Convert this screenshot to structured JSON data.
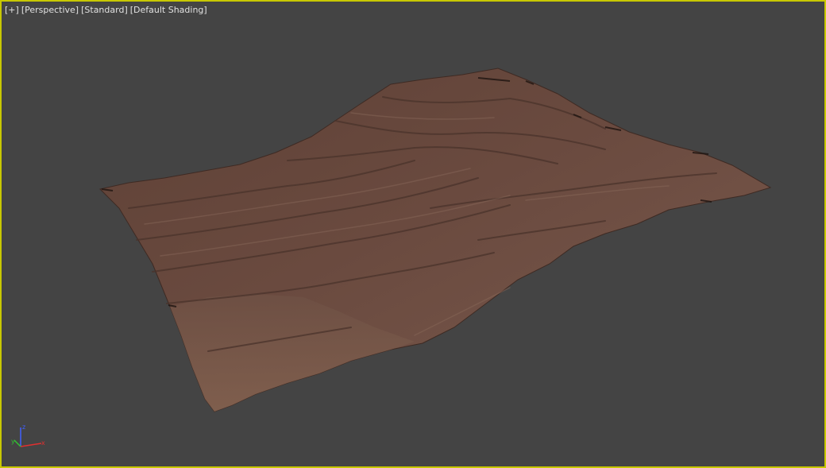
{
  "viewport": {
    "menu_plus": "[+]",
    "menu_view": "[Perspective]",
    "menu_shading_style": "[Standard]",
    "menu_shading_mode": "[Default Shading]",
    "border_color": "#c8c800",
    "background_color": "#444444"
  },
  "object": {
    "name": "terrain-mesh",
    "color": "#6b4c42"
  },
  "gizmo": {
    "x_label": "x",
    "y_label": "y",
    "z_label": "z",
    "x_color": "#e03030",
    "y_color": "#30c030",
    "z_color": "#4060ff"
  }
}
